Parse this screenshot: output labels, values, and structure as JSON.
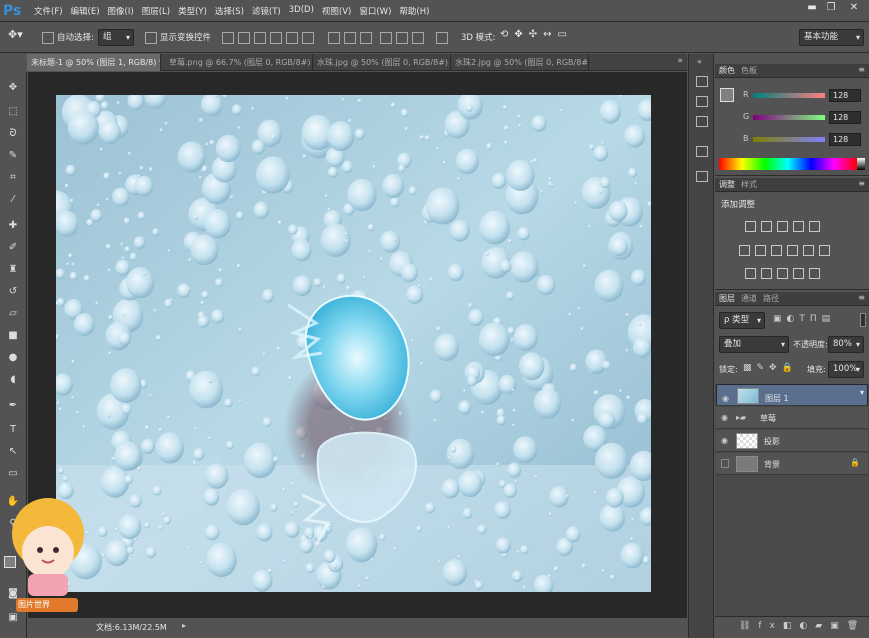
{
  "app": {
    "logo": "Ps"
  },
  "menu": [
    "文件(F)",
    "编辑(E)",
    "图像(I)",
    "图层(L)",
    "类型(Y)",
    "选择(S)",
    "滤镜(T)",
    "3D(D)",
    "视图(V)",
    "窗口(W)",
    "帮助(H)"
  ],
  "window_controls": {
    "minimize": "▬",
    "restore": "❐",
    "close": "✕"
  },
  "options": {
    "auto_select_label": "自动选择:",
    "auto_select_value": "组",
    "show_transform_label": "显示变换控件",
    "mode_3d_label": "3D 模式:",
    "workspace": "基本功能"
  },
  "tabs": [
    {
      "label": "未标题-1 @ 50% (图层 1, RGB/8) *"
    },
    {
      "label": "草莓.png @ 66.7% (图层 0, RGB/8#) *"
    },
    {
      "label": "水珠.jpg @ 50% (图层 0, RGB/8#) *"
    },
    {
      "label": "水珠2.jpg @ 50% (图层 0, RGB/8#) *"
    }
  ],
  "status": {
    "doc_size": "文档:6.13M/22.5M"
  },
  "color_panel": {
    "tabs": [
      "颜色",
      "色板"
    ],
    "r_label": "R",
    "r_value": "128",
    "g_label": "G",
    "g_value": "128",
    "b_label": "B",
    "b_value": "128",
    "fg_color": "#808080"
  },
  "adjust_panel": {
    "tabs": [
      "调整",
      "样式"
    ],
    "title": "添加调整"
  },
  "layers_panel": {
    "tabs": [
      "图层",
      "通道",
      "路径"
    ],
    "filter_label": "ρ 类型",
    "blend_mode": "叠加",
    "opacity_label": "不透明度:",
    "opacity_value": "80%",
    "lock_label": "锁定:",
    "fill_label": "填充:",
    "fill_value": "100%",
    "layers": [
      {
        "name": "图层 1",
        "selected": true
      },
      {
        "name": "草莓",
        "selected": false
      },
      {
        "name": "投影",
        "selected": false
      },
      {
        "name": "背景",
        "selected": false
      }
    ]
  },
  "sticker": {
    "text": "图片世界"
  }
}
